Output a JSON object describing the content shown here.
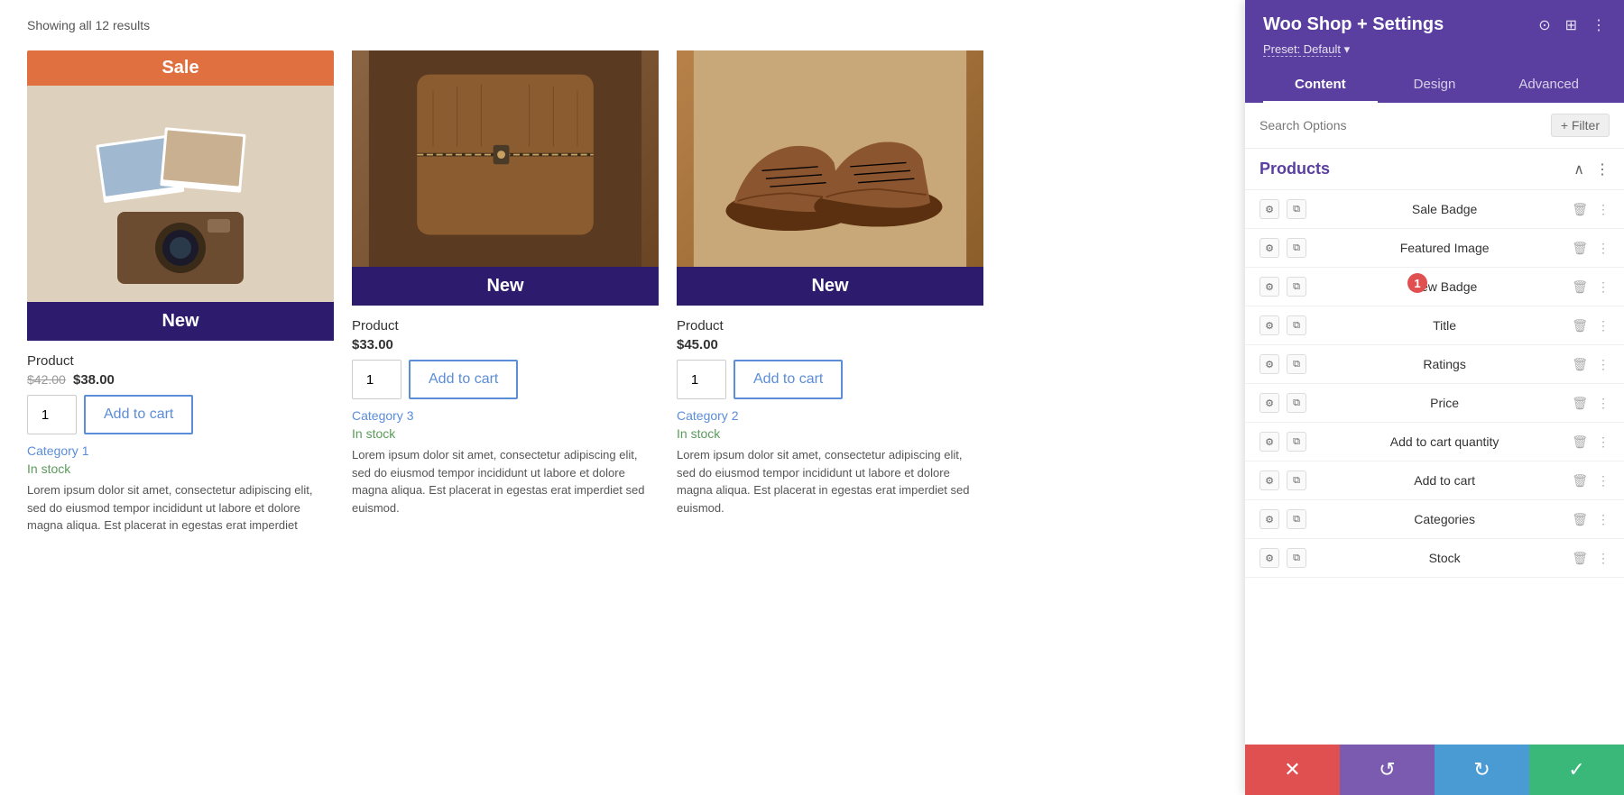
{
  "header": {
    "showing_results": "Showing all 12 results"
  },
  "products": [
    {
      "id": 1,
      "sale_badge": "Sale",
      "new_badge": "New",
      "name": "Product",
      "price_original": "$42.00",
      "price_sale": "$38.00",
      "add_to_cart_label": "Add to cart",
      "qty": "1",
      "category": "Category 1",
      "stock": "In stock",
      "description": "Lorem ipsum dolor sit amet, consectetur adipiscing elit, sed do eiusmod tempor incididunt ut labore et dolore magna aliqua. Est placerat in egestas erat imperdiet",
      "img_type": "camera"
    },
    {
      "id": 2,
      "sale_badge": "",
      "new_badge": "New",
      "name": "Product",
      "price": "$33.00",
      "add_to_cart_label": "Add to cart",
      "qty": "1",
      "category": "Category 3",
      "stock": "In stock",
      "description": "Lorem ipsum dolor sit amet, consectetur adipiscing elit, sed do eiusmod tempor incididunt ut labore et dolore magna aliqua. Est placerat in egestas erat imperdiet sed euismod.",
      "img_type": "bag"
    },
    {
      "id": 3,
      "sale_badge": "",
      "new_badge": "New",
      "name": "Product",
      "price": "$45.00",
      "add_to_cart_label": "Add to cart",
      "qty": "1",
      "category": "Category 2",
      "stock": "In stock",
      "description": "Lorem ipsum dolor sit amet, consectetur adipiscing elit, sed do eiusmod tempor incididunt ut labore et dolore magna aliqua. Est placerat in egestas erat imperdiet sed euismod.",
      "img_type": "shoes"
    }
  ],
  "panel": {
    "title": "Woo Shop + Settings",
    "preset_label": "Preset: Default",
    "tabs": [
      {
        "label": "Content",
        "active": true
      },
      {
        "label": "Design",
        "active": false
      },
      {
        "label": "Advanced",
        "active": false
      }
    ],
    "search_placeholder": "Search Options",
    "filter_label": "+ Filter",
    "sections": [
      {
        "title": "Products",
        "components": [
          {
            "label": "Sale Badge"
          },
          {
            "label": "Featured Image"
          },
          {
            "label": "New Badge"
          },
          {
            "label": "Title"
          },
          {
            "label": "Ratings"
          },
          {
            "label": "Price"
          },
          {
            "label": "Add to cart quantity"
          },
          {
            "label": "Add to cart"
          },
          {
            "label": "Categories"
          },
          {
            "label": "Stock"
          }
        ]
      }
    ],
    "notification_count": "1"
  },
  "toolbar": {
    "cancel_icon": "✕",
    "undo_icon": "↺",
    "redo_icon": "↻",
    "confirm_icon": "✓"
  }
}
